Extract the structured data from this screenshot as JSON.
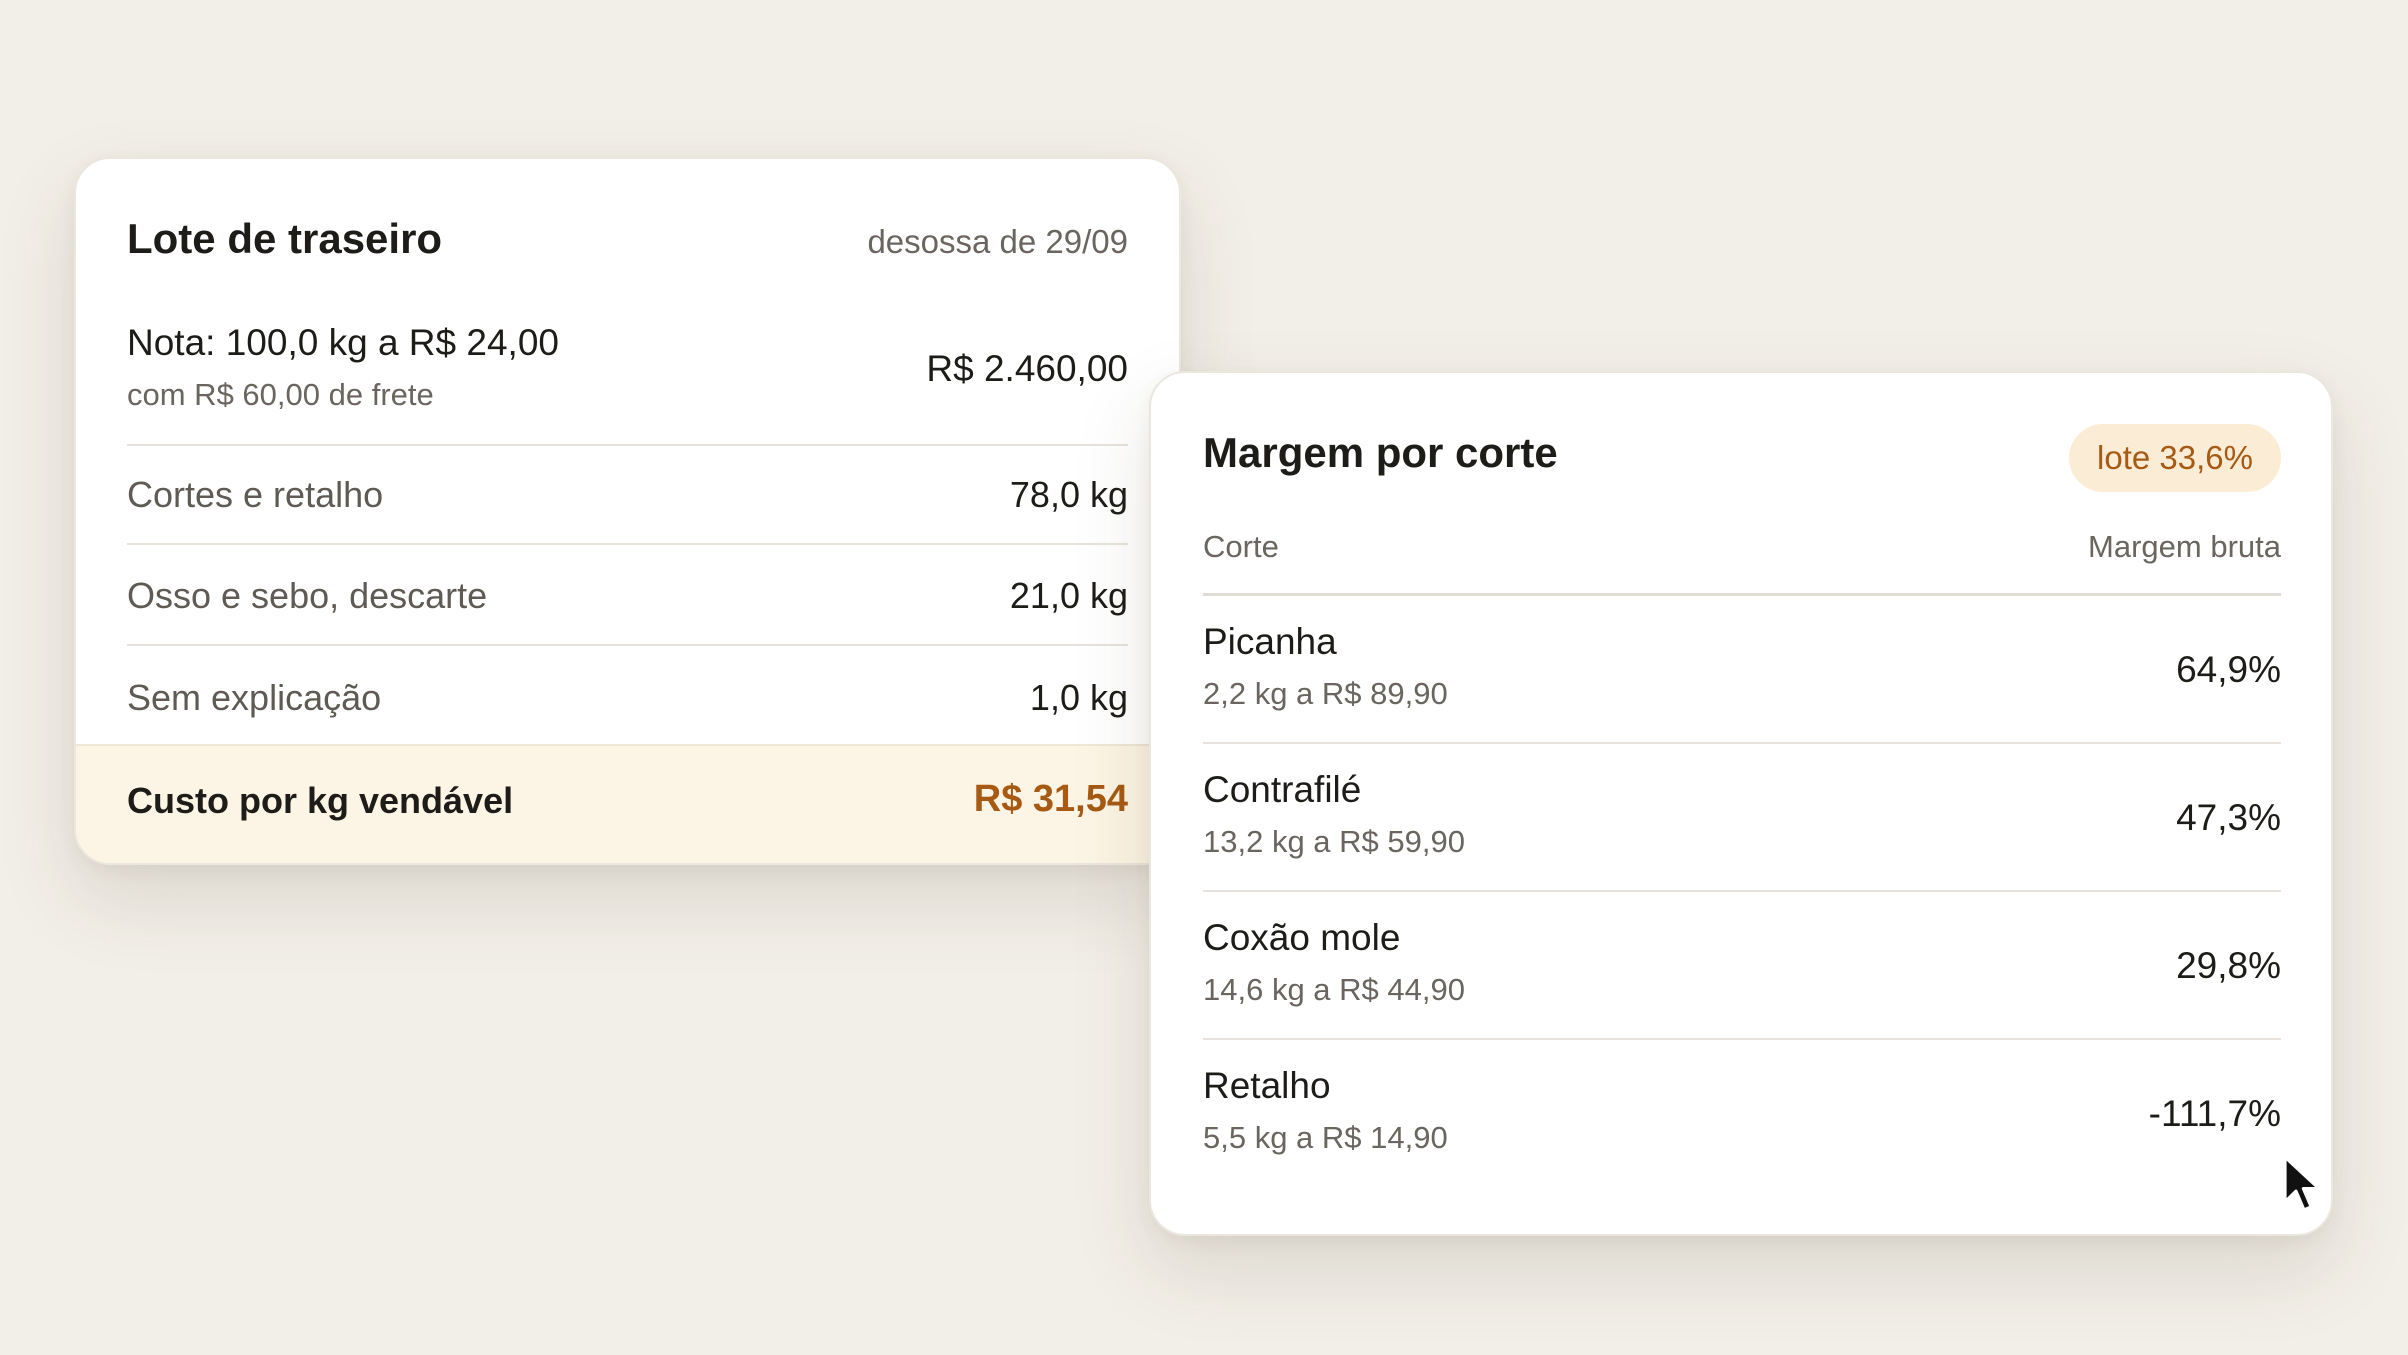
{
  "lot_card": {
    "title": "Lote de traseiro",
    "date": "desossa de 29/09",
    "invoice": {
      "main": "Nota: 100,0 kg a R$ 24,00",
      "sub": "com R$ 60,00 de frete",
      "total": "R$ 2.460,00"
    },
    "yield_rows": [
      {
        "label": "Cortes e retalho",
        "value": "78,0 kg"
      },
      {
        "label": "Osso e sebo, descarte",
        "value": "21,0 kg"
      },
      {
        "label": "Sem explicação",
        "value": "1,0 kg"
      }
    ],
    "cost": {
      "label": "Custo por kg vendável",
      "value": "R$ 31,54"
    }
  },
  "margin_card": {
    "title": "Margem por corte",
    "badge": "lote 33,6%",
    "columns": {
      "cut": "Corte",
      "margin": "Margem bruta"
    },
    "cuts": [
      {
        "name": "Picanha",
        "detail": "2,2 kg a R$ 89,90",
        "margin": "64,9%"
      },
      {
        "name": "Contrafilé",
        "detail": "13,2 kg a R$ 59,90",
        "margin": "47,3%"
      },
      {
        "name": "Coxão mole",
        "detail": "14,6 kg a R$ 44,90",
        "margin": "29,8%"
      },
      {
        "name": "Retalho",
        "detail": "5,5 kg a R$ 14,90",
        "margin": "-111,7%"
      }
    ]
  },
  "colors": {
    "background": "#f2efe8",
    "accent": "#a65a13",
    "highlight_fill": "#fcf4e4",
    "badge_fill": "#fbecd6"
  },
  "icons": {
    "cursor": "mouse-pointer-icon"
  }
}
